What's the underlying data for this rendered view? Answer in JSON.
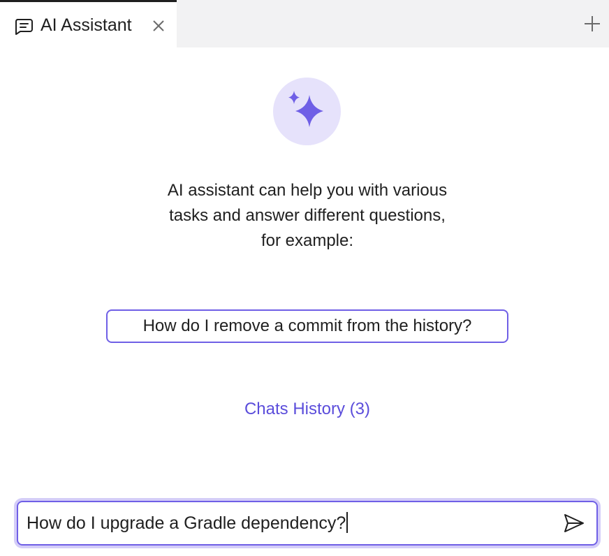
{
  "tab": {
    "title": "AI Assistant"
  },
  "colors": {
    "accent": "#6f5fe6",
    "accent_soft": "#e6e2fb",
    "link": "#5b4ddb",
    "tabbar_bg": "#f2f2f3"
  },
  "icons": {
    "tab": "chat-icon",
    "close": "close-icon",
    "new_tab": "plus-icon",
    "hero": "sparkle-icon",
    "send": "send-icon"
  },
  "intro": {
    "line1": "AI assistant can help you with various",
    "line2": "tasks and answer different questions,",
    "line3": "for example:"
  },
  "suggestion": "How do I remove a commit from the history?",
  "history_link": "Chats History (3)",
  "input": {
    "value": "How do I upgrade a Gradle dependency?"
  }
}
